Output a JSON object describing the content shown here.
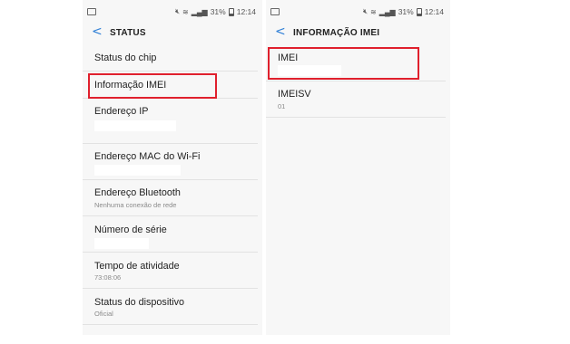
{
  "status_bar": {
    "battery": "31%",
    "time": "12:14"
  },
  "left_screen": {
    "title": "STATUS",
    "items": [
      {
        "label": "Status do chip"
      },
      {
        "label": "Informação IMEI"
      },
      {
        "label": "Endereço IP"
      },
      {
        "label": "Endereço MAC do Wi-Fi"
      },
      {
        "label": "Endereço Bluetooth",
        "sub": "Nenhuma conexão de rede"
      },
      {
        "label": "Número de série"
      },
      {
        "label": "Tempo de atividade",
        "sub": "73:08:06"
      },
      {
        "label": "Status do dispositivo",
        "sub": "Oficial"
      }
    ]
  },
  "right_screen": {
    "title": "INFORMAÇÃO IMEI",
    "items": [
      {
        "label": "IMEI"
      },
      {
        "label": "IMEISV",
        "sub": "01"
      }
    ]
  },
  "colors": {
    "highlight": "#e0202d",
    "accent": "#2f7fd6"
  }
}
